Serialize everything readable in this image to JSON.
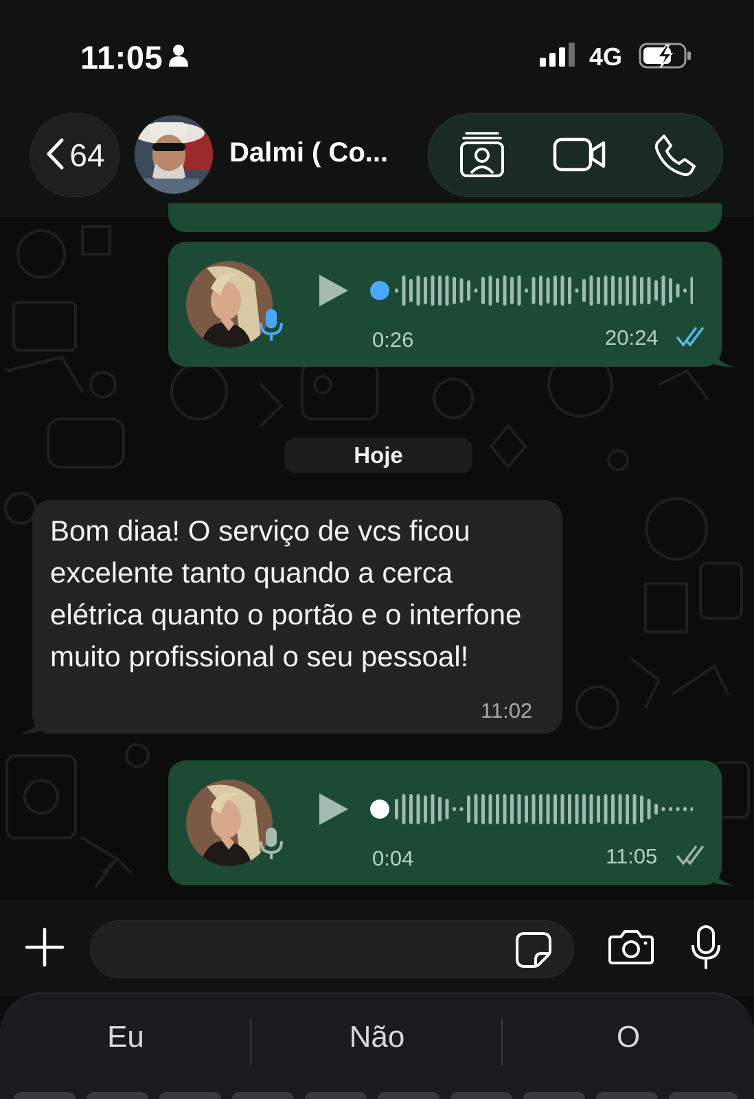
{
  "status_bar": {
    "time": "11:05",
    "network": "4G",
    "icons": [
      "person-icon",
      "signal-icon",
      "battery-charging-icon"
    ]
  },
  "header": {
    "back_count": "64",
    "contact_name": "Dalmi ( Co...",
    "actions": [
      "contact-card-icon",
      "video-call-icon",
      "phone-icon"
    ]
  },
  "messages": [
    {
      "type": "voice",
      "direction": "outgoing",
      "duration": "0:26",
      "time": "20:24",
      "status": "read",
      "progress": 0,
      "play_dot_color": "#4aa8ff",
      "tick_color": "#53bdeb"
    },
    {
      "type": "date_separator",
      "label": "Hoje"
    },
    {
      "type": "text",
      "direction": "incoming",
      "text": "Bom diaa! O serviço de vcs ficou excelente tanto quando a cerca elétrica quanto o portão e o interfone muito profissional o seu pessoal!",
      "time": "11:02"
    },
    {
      "type": "voice",
      "direction": "outgoing",
      "duration": "0:04",
      "time": "11:05",
      "status": "delivered",
      "progress": 0,
      "play_dot_color": "#ffffff",
      "tick_color": "#9fb5ab"
    }
  ],
  "composer": {
    "input_value": "",
    "icons": [
      "plus-icon",
      "sticker-icon",
      "camera-icon",
      "microphone-icon"
    ]
  },
  "keyboard": {
    "suggestions": [
      "Eu",
      "Não",
      "O"
    ]
  },
  "colors": {
    "outgoing_bubble": "#1c4a35",
    "incoming_bubble": "#222423",
    "accent_blue": "#53bdeb"
  }
}
